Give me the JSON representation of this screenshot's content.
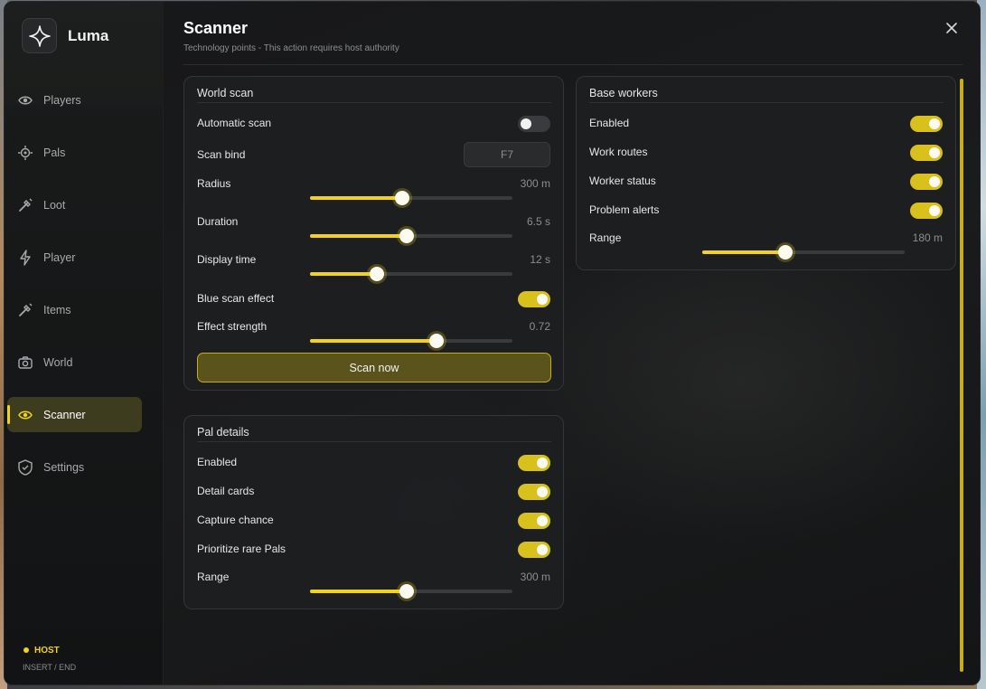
{
  "app": {
    "name": "Luma"
  },
  "sidebar": {
    "items": [
      {
        "label": "Players",
        "icon": "eye-icon",
        "active": false
      },
      {
        "label": "Pals",
        "icon": "target-icon",
        "active": false
      },
      {
        "label": "Loot",
        "icon": "wand-icon",
        "active": false
      },
      {
        "label": "Player",
        "icon": "bolt-icon",
        "active": false
      },
      {
        "label": "Items",
        "icon": "wand-icon",
        "active": false
      },
      {
        "label": "World",
        "icon": "camera-icon",
        "active": false
      },
      {
        "label": "Scanner",
        "icon": "eye-icon",
        "active": true
      },
      {
        "label": "Settings",
        "icon": "shield-icon",
        "active": false
      }
    ],
    "status": {
      "host": "HOST",
      "keys": "INSERT  /  END"
    }
  },
  "header": {
    "title": "Scanner",
    "subtitle": "Technology points - This action requires host authority"
  },
  "world_scan": {
    "title": "World scan",
    "automatic_scan": {
      "label": "Automatic scan",
      "on": false
    },
    "scan_bind": {
      "label": "Scan bind",
      "value": "F7"
    },
    "radius": {
      "label": "Radius",
      "value": "300 m",
      "level": 0.455
    },
    "duration": {
      "label": "Duration",
      "value": "6.5 s",
      "level": 0.478
    },
    "display_time": {
      "label": "Display time",
      "value": "12 s",
      "level": 0.33
    },
    "blue_scan_effect": {
      "label": "Blue scan effect",
      "on": true
    },
    "effect_strength": {
      "label": "Effect strength",
      "value": "0.72",
      "level": 0.625
    },
    "scan_button": "Scan now"
  },
  "pal_details": {
    "title": "Pal details",
    "enabled": {
      "label": "Enabled",
      "on": true
    },
    "detail_cards": {
      "label": "Detail cards",
      "on": true
    },
    "capture_chance": {
      "label": "Capture chance",
      "on": true
    },
    "prioritize_rare": {
      "label": "Prioritize rare Pals",
      "on": true
    },
    "range": {
      "label": "Range",
      "value": "300 m",
      "level": 0.478
    }
  },
  "base_workers": {
    "title": "Base workers",
    "enabled": {
      "label": "Enabled",
      "on": true
    },
    "work_routes": {
      "label": "Work routes",
      "on": true
    },
    "worker_status": {
      "label": "Worker status",
      "on": true
    },
    "problem_alerts": {
      "label": "Problem alerts",
      "on": true
    },
    "range": {
      "label": "Range",
      "value": "180 m",
      "level": 0.41
    }
  },
  "colors": {
    "accent": "#f2d21a",
    "background": "#141517",
    "card": "#1e1f21"
  }
}
